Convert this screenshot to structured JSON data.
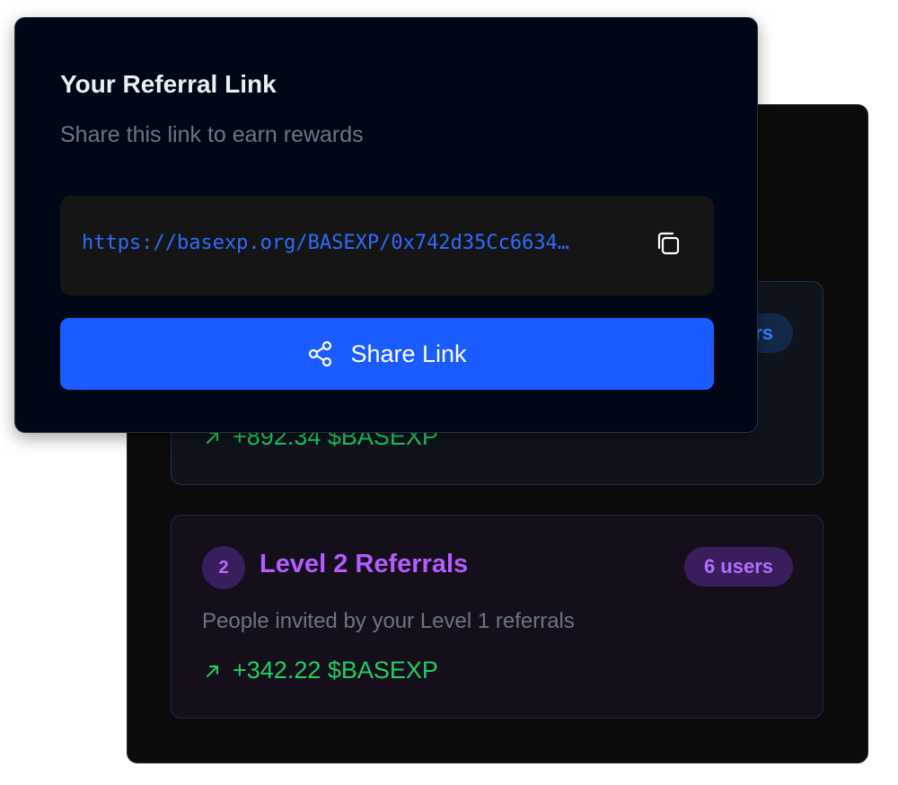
{
  "referral_card": {
    "title": "Your Referral Link",
    "subtitle": "Share this link to earn rewards",
    "link": "https://basexp.org/BASEXP/0x742d35Cc6634…",
    "share_label": "Share Link"
  },
  "levels": [
    {
      "users": "rs",
      "earnings": "+892.34 $BASEXP"
    },
    {
      "number": "2",
      "title": "Level 2 Referrals",
      "users": "6 users",
      "description": "People invited by your Level 1 referrals",
      "earnings": "+342.22 $BASEXP"
    }
  ],
  "colors": {
    "primary": "#1a5cff",
    "positive": "#1fcf62",
    "level2_accent": "#b45cff",
    "level1_accent": "#3a82ff"
  }
}
